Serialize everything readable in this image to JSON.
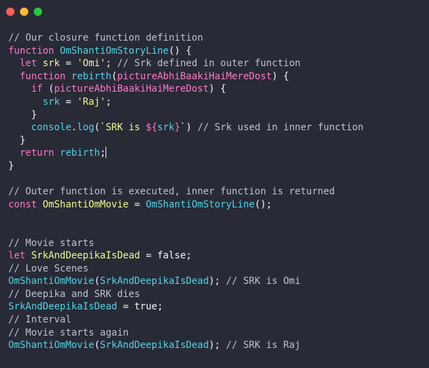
{
  "window": {
    "controls": [
      {
        "name": "close-dot",
        "color": "#ff5f56"
      },
      {
        "name": "minimize-dot",
        "color": "#ffbd2e"
      },
      {
        "name": "maximize-dot",
        "color": "#27c93f"
      }
    ]
  },
  "colors": {
    "background": "#282a36",
    "text": "#f8f8f2",
    "comment": "#bcc3d1",
    "keyword": "#ff79c6",
    "function": "#50d3e6",
    "string": "#f1fa8c",
    "variable": "#f1fa8c",
    "boolean": "#f8f8f2"
  },
  "code": {
    "lines": [
      [
        [
          "// Our closure function definition",
          "comment"
        ]
      ],
      [
        [
          "function ",
          "keyword"
        ],
        [
          "OmShantiOmStoryLine",
          "function"
        ],
        [
          "() {",
          "text"
        ]
      ],
      [
        [
          "  ",
          "text"
        ],
        [
          "let ",
          "keyword"
        ],
        [
          "srk",
          "variable"
        ],
        [
          " = ",
          "text"
        ],
        [
          "'Omi'",
          "string"
        ],
        [
          "; ",
          "text"
        ],
        [
          "// Srk defined in outer function",
          "comment"
        ]
      ],
      [
        [
          "  ",
          "text"
        ],
        [
          "function ",
          "keyword"
        ],
        [
          "rebirth",
          "function"
        ],
        [
          "(",
          "text"
        ],
        [
          "pictureAbhiBaakiHaiMereDost",
          "keyword"
        ],
        [
          ") {",
          "text"
        ]
      ],
      [
        [
          "    ",
          "text"
        ],
        [
          "if ",
          "keyword"
        ],
        [
          "(",
          "text"
        ],
        [
          "pictureAbhiBaakiHaiMereDost",
          "keyword"
        ],
        [
          ") {",
          "text"
        ]
      ],
      [
        [
          "      ",
          "text"
        ],
        [
          "srk",
          "function"
        ],
        [
          " = ",
          "text"
        ],
        [
          "'Raj'",
          "string"
        ],
        [
          ";",
          "text"
        ]
      ],
      [
        [
          "    }",
          "text"
        ]
      ],
      [
        [
          "    ",
          "text"
        ],
        [
          "console",
          "function"
        ],
        [
          ".",
          "text"
        ],
        [
          "log",
          "function"
        ],
        [
          "(",
          "text"
        ],
        [
          "`SRK is ",
          "string"
        ],
        [
          "${",
          "keyword"
        ],
        [
          "srk",
          "function"
        ],
        [
          "}",
          "keyword"
        ],
        [
          "`",
          "string"
        ],
        [
          ") ",
          "text"
        ],
        [
          "// Srk used in inner function",
          "comment"
        ]
      ],
      [
        [
          "  }",
          "text"
        ]
      ],
      [
        [
          "  ",
          "text"
        ],
        [
          "return ",
          "keyword"
        ],
        [
          "rebirth",
          "function"
        ],
        [
          ";",
          "text"
        ],
        [
          "|cursor|",
          "cursor"
        ]
      ],
      [
        [
          "}",
          "text"
        ]
      ],
      [],
      [
        [
          "// Outer function is executed, inner function is returned",
          "comment"
        ]
      ],
      [
        [
          "const ",
          "keyword"
        ],
        [
          "OmShantiOmMovie",
          "variable"
        ],
        [
          " = ",
          "text"
        ],
        [
          "OmShantiOmStoryLine",
          "function"
        ],
        [
          "();",
          "text"
        ]
      ],
      [],
      [],
      [
        [
          "// Movie starts",
          "comment"
        ]
      ],
      [
        [
          "let ",
          "keyword"
        ],
        [
          "SrkAndDeepikaIsDead",
          "variable"
        ],
        [
          " = false;",
          "text"
        ]
      ],
      [
        [
          "// Love Scenes",
          "comment"
        ]
      ],
      [
        [
          "OmShantiOmMovie",
          "function"
        ],
        [
          "(",
          "text"
        ],
        [
          "SrkAndDeepikaIsDead",
          "function"
        ],
        [
          "); ",
          "text"
        ],
        [
          "// SRK is Omi",
          "comment"
        ]
      ],
      [
        [
          "// Deepika and SRK dies",
          "comment"
        ]
      ],
      [
        [
          "SrkAndDeepikaIsDead",
          "function"
        ],
        [
          " = true;",
          "text"
        ]
      ],
      [
        [
          "// Interval",
          "comment"
        ]
      ],
      [
        [
          "// Movie starts again",
          "comment"
        ]
      ],
      [
        [
          "OmShantiOmMovie",
          "function"
        ],
        [
          "(",
          "text"
        ],
        [
          "SrkAndDeepikaIsDead",
          "function"
        ],
        [
          "); ",
          "text"
        ],
        [
          "// SRK is Raj",
          "comment"
        ]
      ]
    ]
  }
}
